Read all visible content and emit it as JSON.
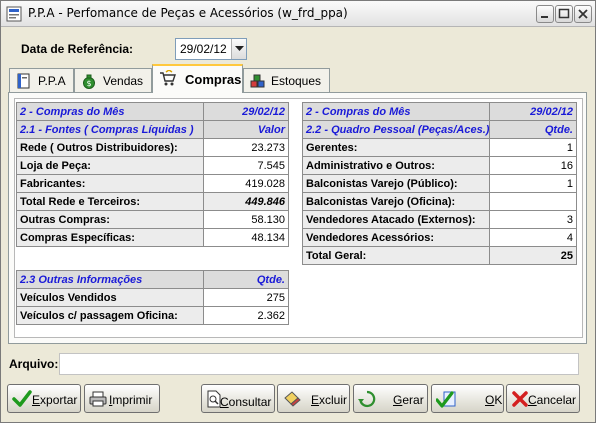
{
  "window": {
    "title": "P.P.A - Perfomance de Peças e Acessórios (w_frd_ppa)"
  },
  "reference": {
    "label": "Data de Referência:",
    "value": "29/02/12"
  },
  "tabs": [
    {
      "label": "P.P.A",
      "icon": "book-icon"
    },
    {
      "label": "Vendas",
      "icon": "money-bag-icon"
    },
    {
      "label": "Compras",
      "icon": "cart-hand-icon",
      "active": true
    },
    {
      "label": "Estoques",
      "icon": "boxes-icon"
    }
  ],
  "compras_fontes": {
    "header": {
      "title": "2 - Compras do Mês",
      "date": "29/02/12"
    },
    "subheader": {
      "title": "2.1 - Fontes ( Compras Líquidas )",
      "col": "Valor"
    },
    "rows": [
      {
        "label": "Rede ( Outros Distribuidores):",
        "value": "23.273"
      },
      {
        "label": "Loja de Peça:",
        "value": "7.545"
      },
      {
        "label": "Fabricantes:",
        "value": "419.028"
      },
      {
        "label": "Total Rede e Terceiros:",
        "value": "449.846"
      },
      {
        "label": "Outras Compras:",
        "value": "58.130"
      },
      {
        "label": "Compras Específicas:",
        "value": "48.134"
      }
    ]
  },
  "outras_informacoes": {
    "header": {
      "title": "2.3 Outras Informações",
      "col": "Qtde."
    },
    "rows": [
      {
        "label": "Veículos Vendidos",
        "value": "275"
      },
      {
        "label": "Veículos c/ passagem Oficina:",
        "value": "2.362"
      }
    ]
  },
  "quadro_pessoal": {
    "header": {
      "title": "2 - Compras do Mês",
      "date": "29/02/12"
    },
    "subheader": {
      "title": "2.2 - Quadro Pessoal (Peças/Aces.)",
      "col": "Qtde."
    },
    "rows": [
      {
        "label": "Gerentes:",
        "value": "1"
      },
      {
        "label": "Administrativo e Outros:",
        "value": "16"
      },
      {
        "label": "Balconistas Varejo (Público):",
        "value": "1"
      },
      {
        "label": "Balconistas Varejo (Oficina):",
        "value": ""
      },
      {
        "label": "Vendedores Atacado (Externos):",
        "value": "3"
      },
      {
        "label": "Vendedores Acessórios:",
        "value": "4"
      },
      {
        "label": "Total Geral:",
        "value": "25"
      }
    ]
  },
  "arquivo": {
    "label": "Arquivo:",
    "value": ""
  },
  "buttons": {
    "exportar": {
      "first": "E",
      "rest": "xportar"
    },
    "imprimir": {
      "first": "I",
      "rest": "mprimir"
    },
    "consultar": {
      "first": "C",
      "rest": "onsultar"
    },
    "excluir": {
      "first": "E",
      "rest": "xcluir"
    },
    "gerar": {
      "first": "G",
      "rest": "erar"
    },
    "ok": {
      "first": "O",
      "rest": "K"
    },
    "cancelar": {
      "first": "C",
      "rest": "ancelar"
    }
  },
  "colors": {
    "header_text": "#1a1ad8",
    "active_tab_accent": "#ffc83c"
  }
}
